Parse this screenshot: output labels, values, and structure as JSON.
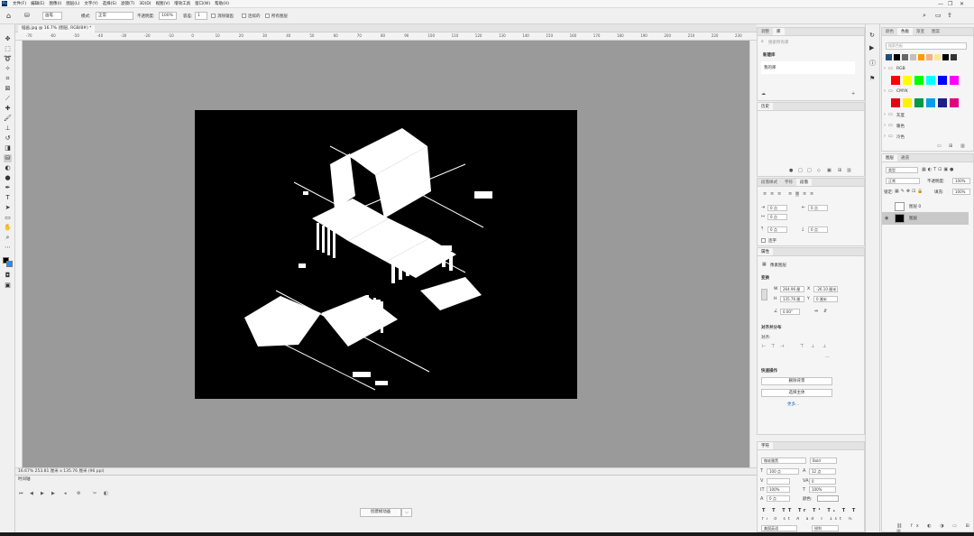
{
  "menubar": {
    "logo": "Ps",
    "items": [
      "文件(F)",
      "编辑(E)",
      "图像(I)",
      "图层(L)",
      "文字(Y)",
      "选择(S)",
      "滤镜(T)",
      "3D(D)",
      "视图(V)",
      "增效工具",
      "窗口(W)",
      "帮助(H)"
    ],
    "min": "—",
    "restore": "❐",
    "close": "✕"
  },
  "options": {
    "brush_preset": "画笔",
    "mode_label": "模式:",
    "mode_value": "正常",
    "opacity_label": "不透明度:",
    "opacity_value": "100%",
    "tolerance_label": "容差:",
    "tolerance_value": "1",
    "antialias_label": "消除锯齿",
    "contiguous_label": "连续的",
    "all_layers_label": "所有图层"
  },
  "document": {
    "tab_title": "插画.jpg @ 16.7% (图层, RGB/8#) *",
    "ruler_ticks": [
      "-70",
      "-60",
      "-50",
      "-40",
      "-30",
      "-20",
      "-10",
      "0",
      "10",
      "20",
      "30",
      "40",
      "50",
      "60",
      "70",
      "80",
      "90",
      "100",
      "110",
      "120",
      "130",
      "140",
      "150",
      "160",
      "170",
      "180",
      "190",
      "200",
      "210",
      "220",
      "230"
    ],
    "status": "16.67%  253.81 厘米 x 135.76 厘米 (96 ppi)"
  },
  "timeline": {
    "title": "时间轴",
    "create_label": "创建帧动画",
    "dropdown": "⌵"
  },
  "libraries": {
    "tabs": [
      "调整",
      "库"
    ],
    "search_placeholder": "搜索所有库",
    "new_library": "新建库",
    "my_library": "我的库",
    "history_title": "历史"
  },
  "paragraph": {
    "tabs": [
      "段落样式",
      "字符",
      "段落"
    ],
    "indent_left": "0 点",
    "indent_right": "0 点",
    "indent_first": "0 点",
    "space_before": "0 点",
    "space_after": "0 点",
    "hyphenate": "连字"
  },
  "properties": {
    "title": "属性",
    "pixel_layer": "像素图层",
    "transform": "变换",
    "w_label": "W",
    "w_value": "264.96 厘",
    "x_label": "X",
    "x_value": "-26.10 厘米",
    "h_label": "H",
    "h_value": "135.76 厘",
    "y_label": "Y",
    "y_value": "0 厘米",
    "angle_value": "0.00°",
    "align_title": "对齐并分布",
    "align_label": "对齐:",
    "quick_title": "快速操作",
    "remove_bg": "删除背景",
    "select_subject": "选择主体",
    "more": "更多..."
  },
  "character": {
    "title": "字符",
    "font": "微软雅黑",
    "style": "Bold",
    "size": "100 点",
    "leading": "12 点",
    "tracking": "0",
    "vscale": "100%",
    "hscale": "100%",
    "baseline": "0 点",
    "color_label": "颜色:",
    "language": "美国英语",
    "aa": "锐利"
  },
  "swatches": {
    "tabs": [
      "颜色",
      "色板",
      "渐变",
      "图案"
    ],
    "search_placeholder": "搜索色板",
    "groups": [
      "RGB",
      "CMYK",
      "灰度",
      "暖色",
      "冷色"
    ],
    "recent_colors": [
      "#1f4e79",
      "#000000",
      "#666666",
      "#c0c0c0",
      "#ff9900",
      "#f4b183",
      "#ffe699",
      "#000000",
      "#333333"
    ],
    "rgb_colors": [
      "#ff0000",
      "#ffff00",
      "#00ff00",
      "#00ffff",
      "#0000ff",
      "#ff00ff"
    ],
    "cmyk_colors": [
      "#e60012",
      "#fff100",
      "#009944",
      "#00a0e9",
      "#1d2088",
      "#e4007f"
    ]
  },
  "layers": {
    "tabs": [
      "图层",
      "通道"
    ],
    "kind": "类型",
    "blend": "正常",
    "opacity_label": "不透明度:",
    "opacity_value": "100%",
    "lock_label": "锁定:",
    "fill_label": "填充:",
    "fill_value": "100%",
    "items": [
      {
        "name": "图层 0",
        "selected": false
      },
      {
        "name": "图层",
        "selected": true
      }
    ]
  }
}
